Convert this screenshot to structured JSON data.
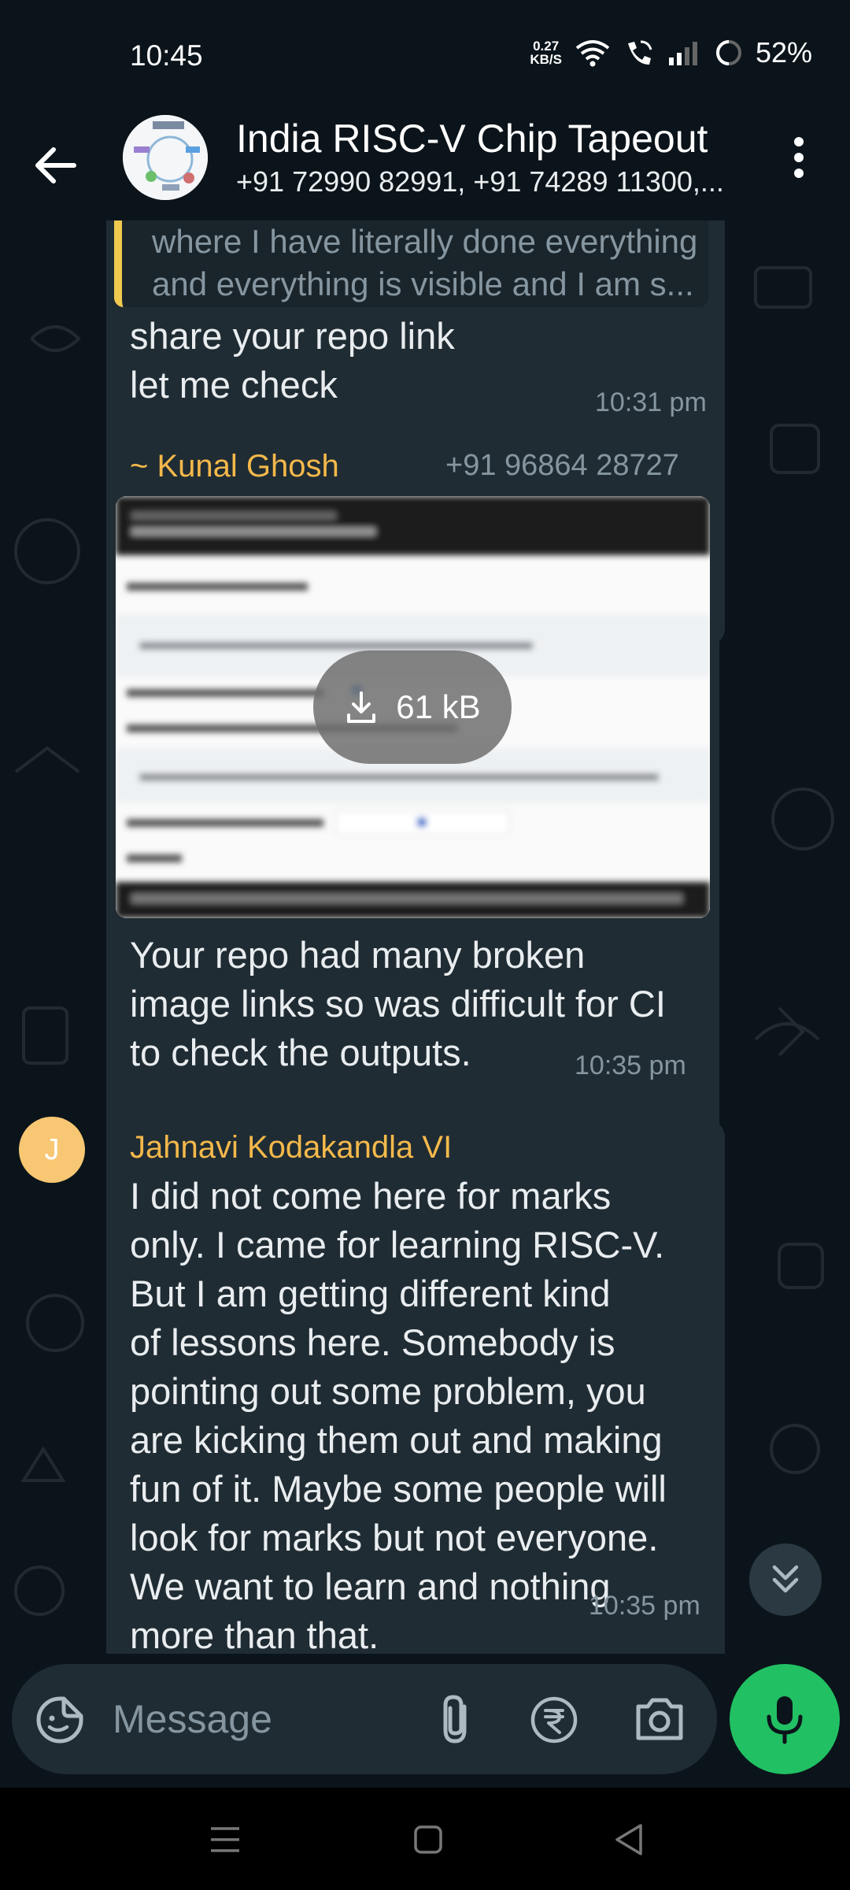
{
  "status_bar": {
    "time": "10:45",
    "net_speed_value": "0.27",
    "net_speed_unit": "KB/S",
    "battery": "52%"
  },
  "header": {
    "title": "India RISC-V Chip Tapeout",
    "subtitle": "+91 72990 82991, +91 74289 11300,..."
  },
  "messages": {
    "m1": {
      "quoted_text": "where I have literally done everything\nand everything is visible and I am s...",
      "text": "share your repo link\nlet me check",
      "time": "10:31 pm"
    },
    "m2": {
      "sender": "~ Kunal Ghosh",
      "phone": "+91 96864 28727",
      "attachment_size": "61 kB",
      "text": "Your repo had many broken\nimage links so was difficult for CI\nto check the outputs.",
      "time": "10:35 pm"
    },
    "m3": {
      "avatar_letter": "J",
      "sender": "Jahnavi Kodakandla VI",
      "text": "I did not come here for marks\nonly. I came for learning RISC-V.\nBut I am getting different kind\nof lessons here. Somebody is\npointing out some problem, you\nare kicking them out and making\nfun of it. Maybe some people will\nlook for marks but not everyone.\nWe want to learn and nothing\nmore than that.",
      "time": "10:35 pm"
    }
  },
  "composer": {
    "placeholder": "Message"
  },
  "colors": {
    "background": "#0b141a",
    "bubble": "#202c33",
    "sender_accent": "#f5b94b",
    "send_green": "#21c063"
  },
  "icons": [
    "back-arrow-icon",
    "more-vert-icon",
    "download-icon",
    "double-chevron-down-icon",
    "emoji-icon",
    "attach-icon",
    "rupee-icon",
    "camera-icon",
    "mic-icon"
  ]
}
